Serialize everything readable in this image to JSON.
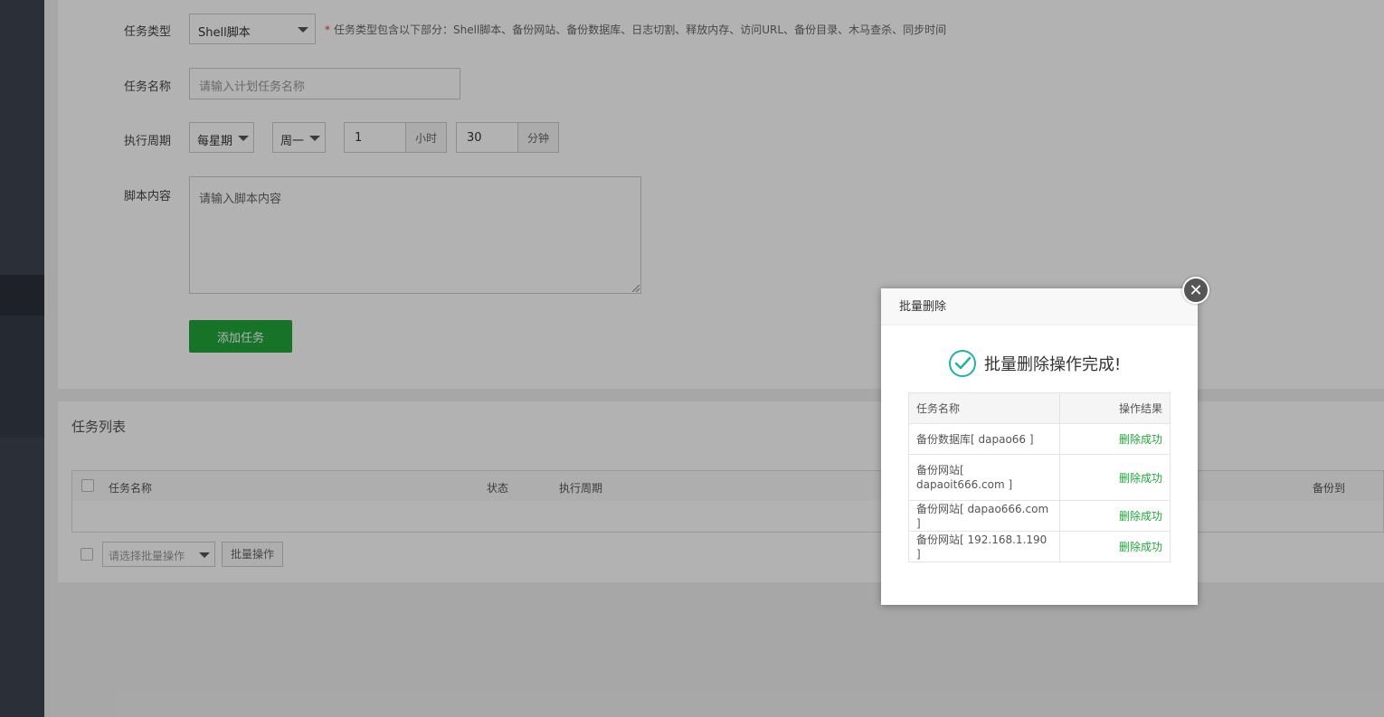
{
  "form": {
    "task_type_label": "任务类型",
    "task_type_value": "Shell脚本",
    "task_type_hint_star": "*",
    "task_type_hint": "任务类型包含以下部分：Shell脚本、备份网站、备份数据库、日志切割、释放内存、访问URL、备份目录、木马查杀、同步时间",
    "task_name_label": "任务名称",
    "task_name_placeholder": "请输入计划任务名称",
    "period_label": "执行周期",
    "period_type": "每星期",
    "period_day": "周一",
    "hour_value": "1",
    "hour_unit": "小时",
    "minute_value": "30",
    "minute_unit": "分钟",
    "script_label": "脚本内容",
    "script_placeholder": "请输入脚本内容",
    "add_button": "添加任务"
  },
  "task_list": {
    "title": "任务列表",
    "columns": [
      "任务名称",
      "状态",
      "执行周期",
      "备份到"
    ],
    "batch_select_placeholder": "请选择批量操作",
    "batch_button": "批量操作"
  },
  "modal": {
    "title": "批量删除",
    "close_glyph": "✕",
    "message": "批量删除操作完成!",
    "table_headers": [
      "任务名称",
      "操作结果"
    ],
    "rows": [
      {
        "name": "备份数据库[ dapao66 ]",
        "result": "删除成功"
      },
      {
        "name": "备份网站[ dapaoit666.com ]",
        "result": "删除成功"
      },
      {
        "name": "备份网站[ dapao666.com ]",
        "result": "删除成功"
      },
      {
        "name": "备份网站[ 192.168.1.190 ]",
        "result": "删除成功"
      }
    ]
  },
  "colors": {
    "accent_green": "#20a53a",
    "sidebar": "#3e4451",
    "hint_star": "#e53e3e"
  }
}
